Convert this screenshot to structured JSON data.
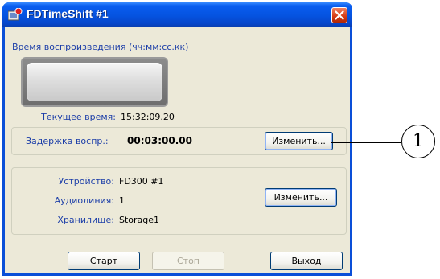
{
  "window": {
    "title": "FDTimeShift #1"
  },
  "playback": {
    "time_format_label": "Время воспроизведения (чч:мм:сс.кк)",
    "current_time_label": "Текущее время:",
    "current_time_value": "15:32:09.20"
  },
  "delay": {
    "label": "Задержка воспр.:",
    "value": "00:03:00.00",
    "change_button": "Изменить..."
  },
  "device": {
    "device_label": "Устройство:",
    "device_value": "FD300 #1",
    "audio_label": "Аудиолиния:",
    "audio_value": "1",
    "storage_label": "Хранилище:",
    "storage_value": "Storage1",
    "change_button": "Изменить..."
  },
  "footer": {
    "start_button": "Старт",
    "stop_button": "Стоп",
    "exit_button": "Выход"
  },
  "callout": {
    "number": "1"
  },
  "colors": {
    "titlebar": "#0553e0",
    "close_button": "#d43a14",
    "dialog_background": "#ece9d8",
    "label_blue": "#1c3ea8",
    "button_border": "#003c74"
  }
}
